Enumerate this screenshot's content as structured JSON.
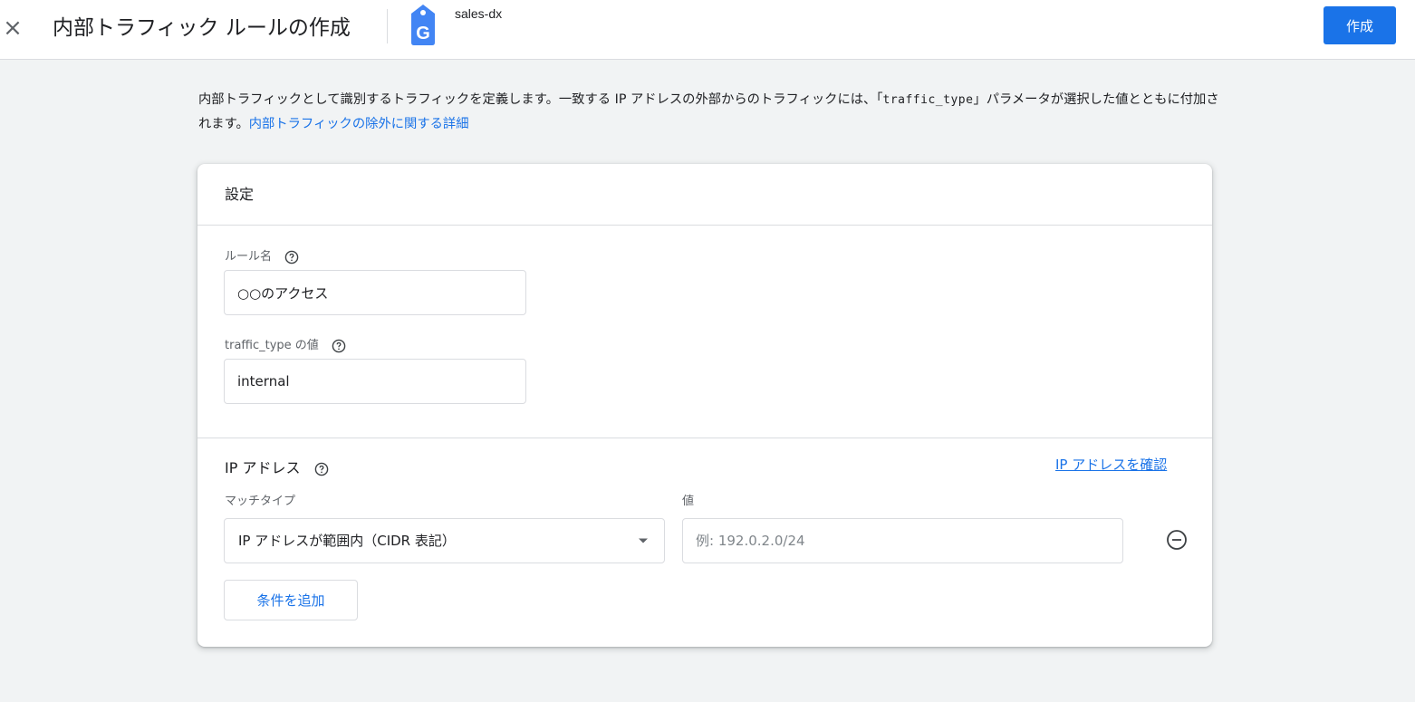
{
  "header": {
    "close_symbol": "×",
    "title": "内部トラフィック ルールの作成",
    "property_icon": "google-analytics-tag-icon",
    "property_letter": "G",
    "property_name": "sales-dx",
    "create_label": "作成",
    "accent_color": "#1a73e8"
  },
  "description": {
    "text_part1": "内部トラフィックとして識別するトラフィックを定義します。一致する IP アドレスの外部からのトラフィックには、「",
    "param_code": "traffic_type",
    "text_part2": "」パラメータが選択した値とともに付加されます。",
    "link_text": "内部トラフィックの除外に関する詳細"
  },
  "settings": {
    "title": "設定",
    "rule_name": {
      "label": "ルール名",
      "value": "○○のアクセス"
    },
    "traffic_type": {
      "label": "traffic_type の値",
      "value": "internal"
    },
    "ip_address": {
      "title": "IP アドレス",
      "check_link": "IP アドレスを確認",
      "match_type_label": "マッチタイプ",
      "match_type_value": "IP アドレスが範囲内（CIDR 表記）",
      "value_label": "値",
      "value_placeholder": "例: 192.0.2.0/24",
      "add_condition_label": "条件を追加"
    }
  }
}
